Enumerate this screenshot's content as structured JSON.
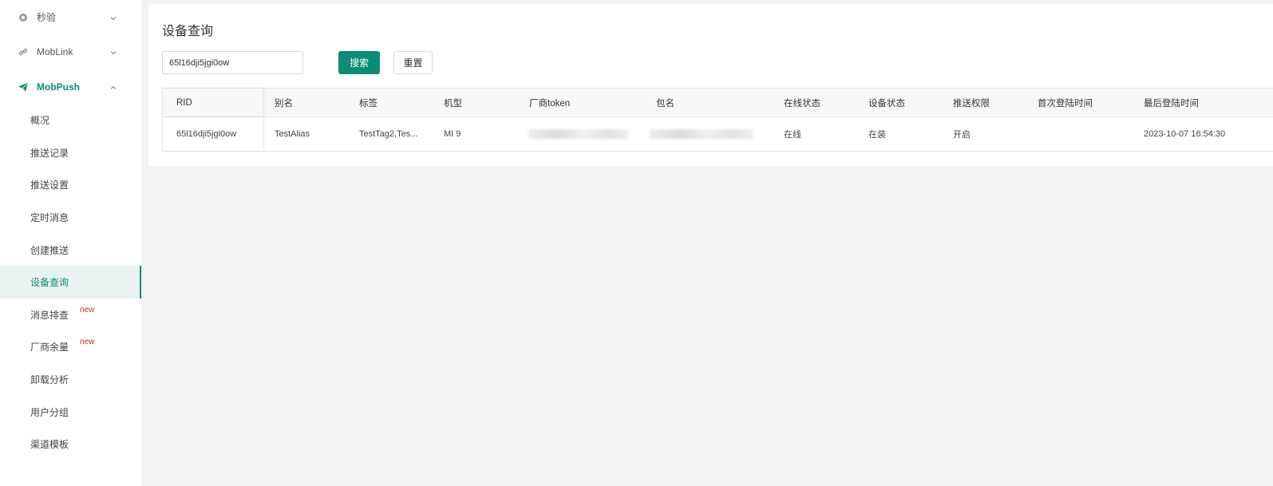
{
  "sidebar": {
    "groups": [
      {
        "label": "秒验",
        "icon": "clock-icon"
      },
      {
        "label": "MobLink",
        "icon": "link-icon"
      },
      {
        "label": "MobPush",
        "icon": "paper-plane-icon"
      }
    ],
    "items": [
      {
        "label": "概况"
      },
      {
        "label": "推送记录"
      },
      {
        "label": "推送设置"
      },
      {
        "label": "定时消息"
      },
      {
        "label": "创建推送"
      },
      {
        "label": "设备查询"
      },
      {
        "label": "消息排查",
        "badge": "new"
      },
      {
        "label": "厂商余量",
        "badge": "new"
      },
      {
        "label": "卸载分析"
      },
      {
        "label": "用户分组"
      },
      {
        "label": "渠道模板"
      }
    ]
  },
  "main": {
    "title": "设备查询",
    "search_value": "65l16dji5jgi0ow",
    "search_button": "搜索",
    "reset_button": "重置"
  },
  "table": {
    "headers": [
      "RID",
      "别名",
      "标签",
      "机型",
      "厂商token",
      "包名",
      "在线状态",
      "设备状态",
      "推送权限",
      "首次登陆时间",
      "最后登陆时间"
    ],
    "rows": [
      {
        "rid": "65l16dji5jgi0ow",
        "alias": "TestAlias",
        "tags": "TestTag2,Tes...",
        "model": "MI 9",
        "online": "在线",
        "device_status": "在装",
        "push_permission": "开启",
        "first_login": "",
        "last_login": "2023-10-07 16:54:30"
      }
    ]
  },
  "colors": {
    "accent": "#0b8c74",
    "new_badge": "#e02020"
  }
}
